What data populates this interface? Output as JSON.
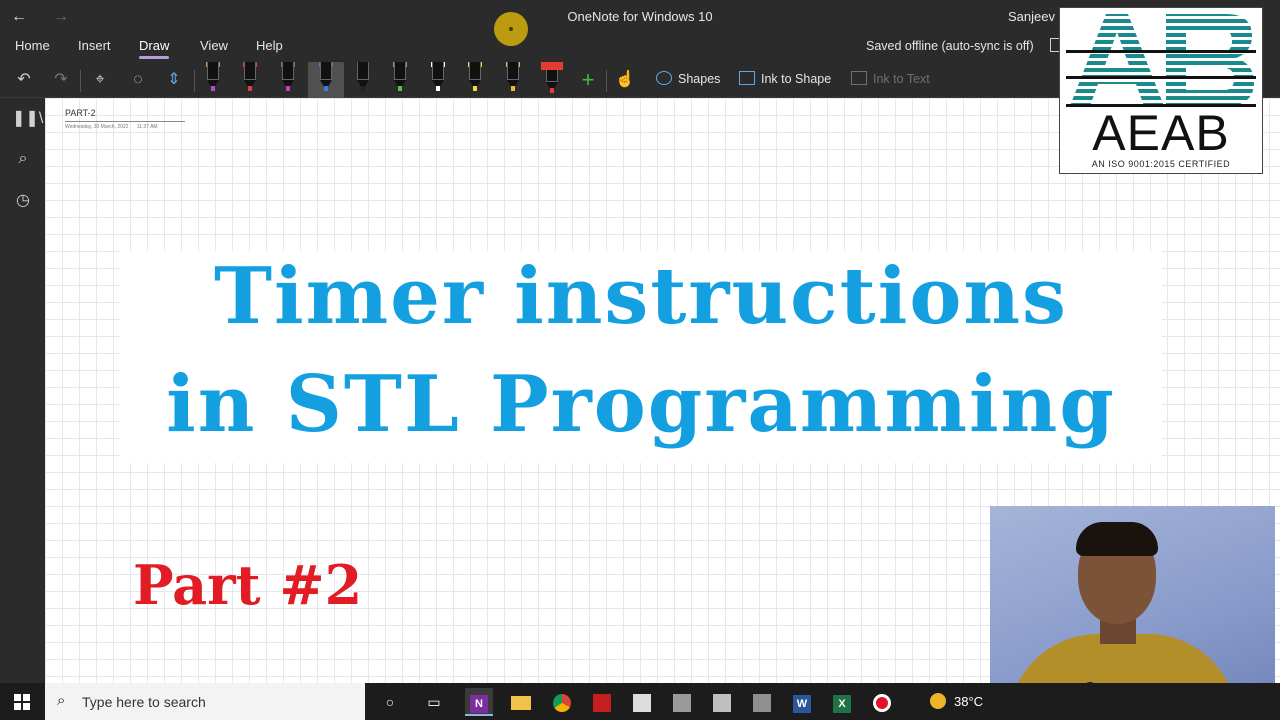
{
  "window": {
    "title": "OneNote for Windows 10",
    "user_name": "Sanjeev K",
    "back_glyph": "←",
    "forward_glyph": "→"
  },
  "menu": {
    "tabs": [
      "Home",
      "Insert",
      "Draw",
      "View",
      "Help"
    ],
    "active_tab": "Draw",
    "sync_status": "Saved offline (auto-sync is off)"
  },
  "toolbar": {
    "shapes_label": "Shapes",
    "ink_to_shape_label": "Ink to Shape",
    "ink_to_text_label": "Ink to Text",
    "pens": [
      {
        "name": "pen-orange-band",
        "band": "#e98a2a",
        "nib": "#b14bd0"
      },
      {
        "name": "pen-red",
        "band": "#e23b4a",
        "nib": "#e23b4a"
      },
      {
        "name": "pen-magenta",
        "band": "#c83cc8",
        "nib": "#c83cc8"
      },
      {
        "name": "pen-blue",
        "band": "#3b7de0",
        "nib": "#3b7de0"
      },
      {
        "name": "pen-black",
        "band": "#222222",
        "nib": "#222222"
      },
      {
        "name": "pen-green",
        "band": "#57c440",
        "nib": "#57c440"
      },
      {
        "name": "pen-white",
        "band": "#ffffff",
        "nib": "#ffffff"
      },
      {
        "name": "pen-yellow",
        "band": "#f3d83a",
        "nib": "#f3d83a"
      },
      {
        "name": "pen-gold",
        "band": "#f0b53a",
        "nib": "#f0b53a"
      },
      {
        "name": "highlighter-red",
        "band": "#e63b2e",
        "nib": "#e63b2e"
      }
    ],
    "accent": "#b59ddc"
  },
  "page": {
    "title": "PART-2",
    "date": "Wednesday, 30 March, 2022",
    "time": "11:37 AM",
    "heading_line1": "Timer instructions",
    "heading_line2": "in STL Programming",
    "part_label": "Part #2",
    "heading_color": "#139fe0",
    "part_color": "#e11c24"
  },
  "logo": {
    "mark": "AB",
    "name": "AEAB",
    "tagline": "AN ISO 9001:2015 CERTIFIED",
    "stripe_color": "#1b8a8c"
  },
  "taskbar": {
    "search_placeholder": "Type here to search",
    "temperature": "38°C",
    "apps": [
      "task-view",
      "onenote",
      "file-explorer",
      "chrome",
      "acrobat",
      "snipping-tool",
      "calculator",
      "app-8",
      "app-9",
      "word",
      "excel",
      "recorder"
    ]
  }
}
